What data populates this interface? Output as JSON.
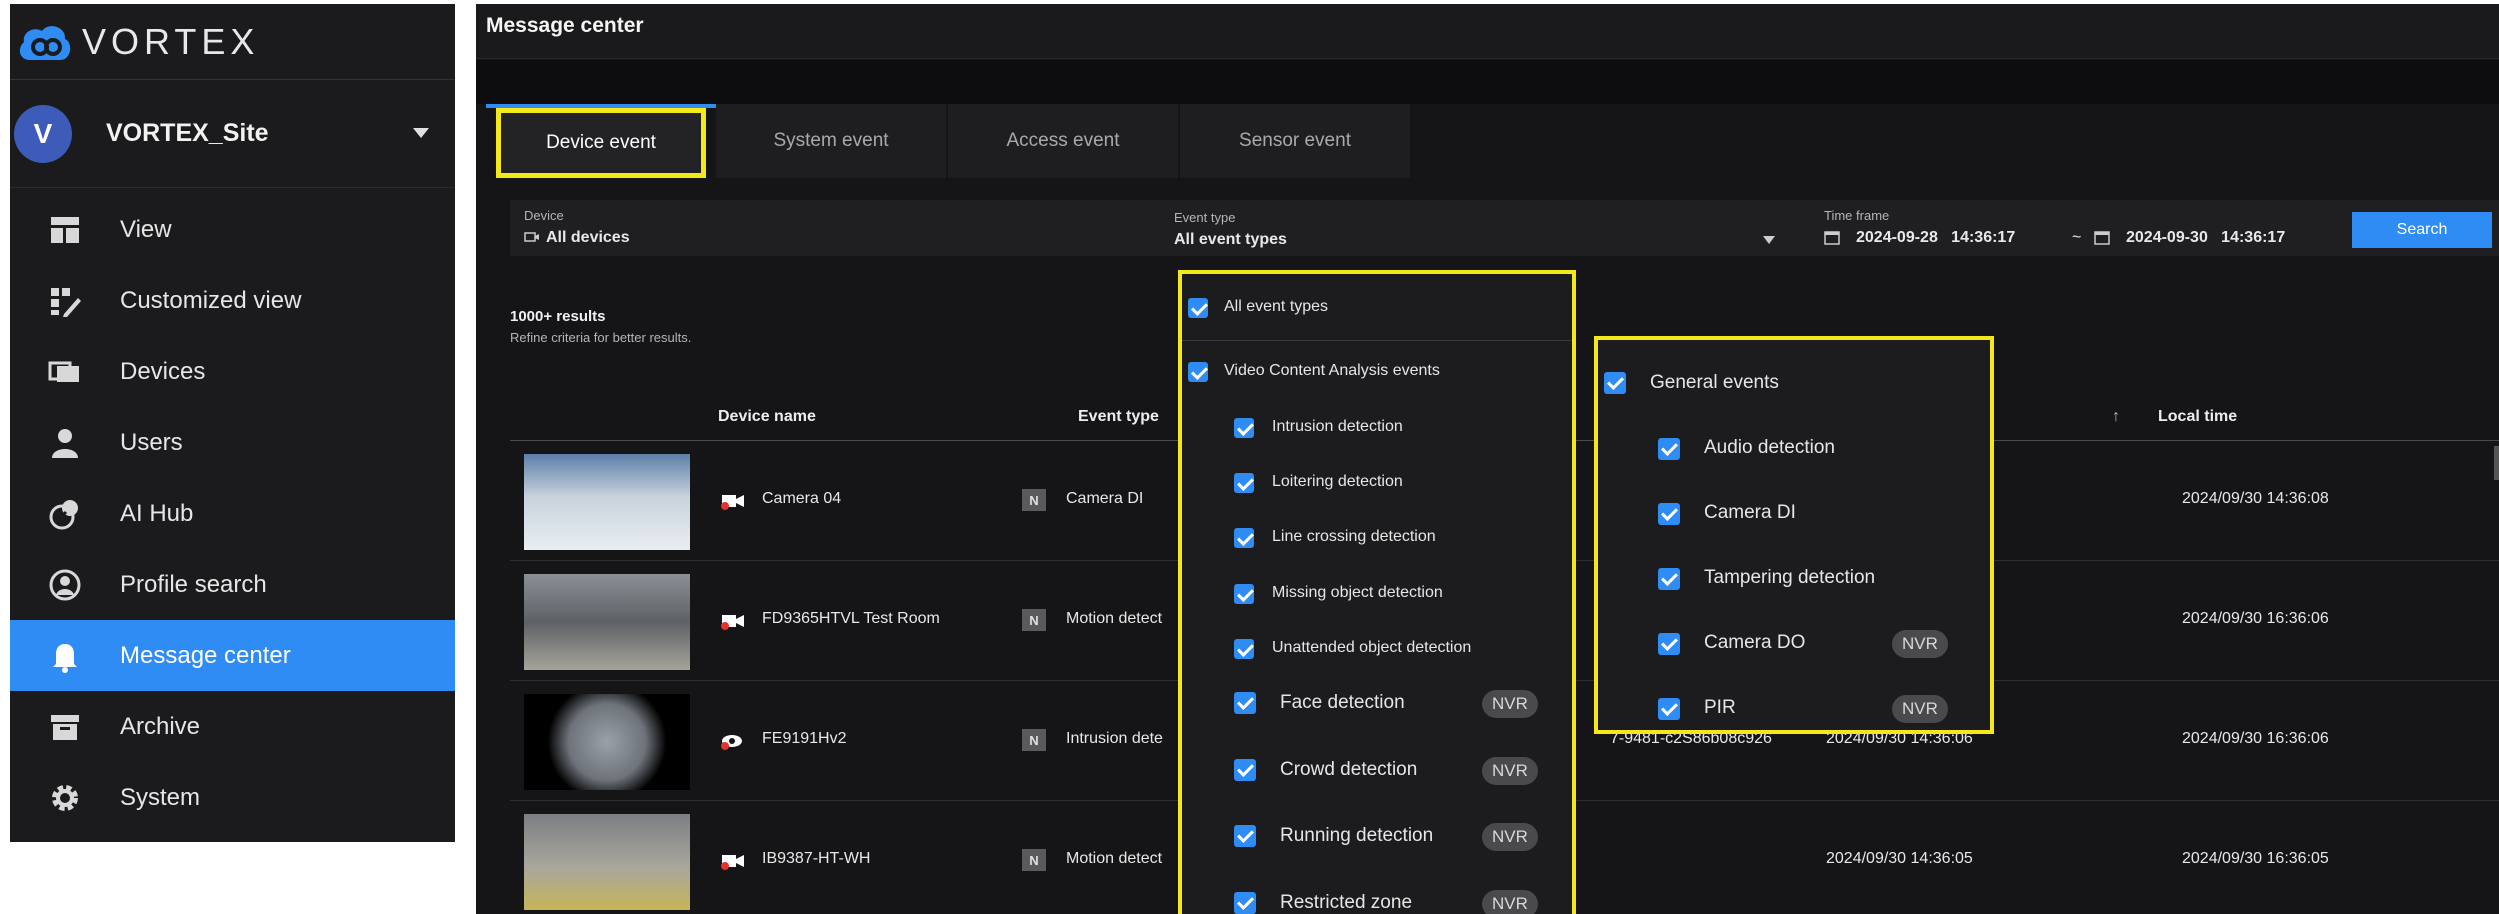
{
  "brand": {
    "name": "VORTEX",
    "logo_color": "#2f8cf5"
  },
  "site": {
    "initial": "V",
    "name": "VORTEX_Site"
  },
  "nav": {
    "items": [
      {
        "label": "View",
        "icon": "layout-icon",
        "active": false
      },
      {
        "label": "Customized view",
        "icon": "custom-grid-icon",
        "active": false
      },
      {
        "label": "Devices",
        "icon": "devices-icon",
        "active": false
      },
      {
        "label": "Users",
        "icon": "user-icon",
        "active": false
      },
      {
        "label": "AI Hub",
        "icon": "ai-hub-icon",
        "active": false
      },
      {
        "label": "Profile search",
        "icon": "profile-search-icon",
        "active": false
      },
      {
        "label": "Message center",
        "icon": "bell-icon",
        "active": true
      },
      {
        "label": "Archive",
        "icon": "archive-icon",
        "active": false
      },
      {
        "label": "System",
        "icon": "gear-icon",
        "active": false
      }
    ]
  },
  "page": {
    "title": "Message center"
  },
  "tabs": [
    "Device event",
    "System event",
    "Access event",
    "Sensor event"
  ],
  "filters": {
    "device_label": "Device",
    "device_value": "All devices",
    "event_type_label": "Event type",
    "event_type_value": "All event types",
    "time_label": "Time frame",
    "time_from": "2024-09-28   14:36:17",
    "time_sep": "~",
    "time_to": "2024-09-30   14:36:17",
    "search": "Search"
  },
  "results": {
    "count": "1000+ results",
    "hint": "Refine criteria for better results."
  },
  "table": {
    "columns": {
      "device": "Device name",
      "event": "Event type",
      "sort_arrow": "↑",
      "local": "Local time"
    },
    "rows": [
      {
        "device": "Camera 04",
        "badge": "N",
        "event": "Camera DI",
        "time": "2024/09/30 14:36:08",
        "time2": "",
        "extra": ""
      },
      {
        "device": "FD9365HTVL Test Room",
        "badge": "N",
        "event": "Motion detect",
        "time": "2024/09/30 16:36:06",
        "time2": "",
        "extra": ""
      },
      {
        "device": "FE9191Hv2",
        "badge": "N",
        "event": "Intrusion dete",
        "time": "2024/09/30 16:36:06",
        "time2": "2024/09/30 14:36:06",
        "extra": "7-9481-c2S86b08c926"
      },
      {
        "device": "IB9387-HT-WH",
        "badge": "N",
        "event": "Motion detect",
        "time": "2024/09/30 16:36:05",
        "time2": "2024/09/30 14:36:05",
        "extra": ""
      }
    ]
  },
  "event_panel": {
    "all": "All event types",
    "vca": "Video Content Analysis events",
    "options": [
      {
        "label": "Intrusion detection",
        "nvr": ""
      },
      {
        "label": "Loitering detection",
        "nvr": ""
      },
      {
        "label": "Line crossing detection",
        "nvr": ""
      },
      {
        "label": "Missing object detection",
        "nvr": ""
      },
      {
        "label": "Unattended object detection",
        "nvr": ""
      },
      {
        "label": "Face detection",
        "nvr": "NVR"
      },
      {
        "label": "Crowd detection",
        "nvr": "NVR"
      },
      {
        "label": "Running detection",
        "nvr": "NVR"
      },
      {
        "label": "Restricted zone",
        "nvr": "NVR"
      }
    ]
  },
  "general_panel": {
    "title": "General events",
    "options": [
      {
        "label": "Audio detection",
        "nvr": ""
      },
      {
        "label": "Camera DI",
        "nvr": ""
      },
      {
        "label": "Tampering detection",
        "nvr": ""
      },
      {
        "label": "Camera DO",
        "nvr": "NVR"
      },
      {
        "label": "PIR",
        "nvr": "NVR"
      }
    ]
  },
  "colors": {
    "accent": "#2f8cf5",
    "highlight": "#f4e81c",
    "background": "#151517"
  }
}
